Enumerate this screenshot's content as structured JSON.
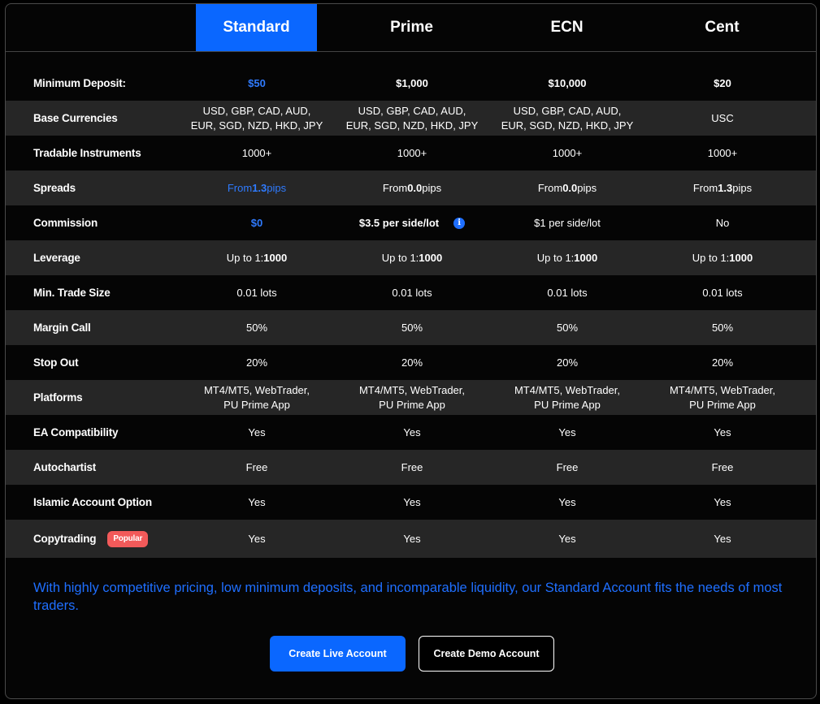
{
  "header": {
    "columns": [
      "Standard",
      "Prime",
      "ECN",
      "Cent"
    ]
  },
  "rows": [
    {
      "label": "Minimum Deposit:",
      "values": [
        "$50",
        "$1,000",
        "$10,000",
        "$20"
      ]
    },
    {
      "label": "Base Currencies",
      "values": [
        "USD, GBP, CAD, AUD,\nEUR, SGD, NZD, HKD, JPY",
        "USD, GBP, CAD, AUD,\nEUR, SGD, NZD, HKD, JPY",
        "USD, GBP, CAD, AUD,\nEUR, SGD, NZD, HKD, JPY",
        "USC"
      ]
    },
    {
      "label": "Tradable Instruments",
      "values": [
        "1000+",
        "1000+",
        "1000+",
        "1000+"
      ]
    },
    {
      "label": "Spreads",
      "values": [
        "From 1.3 pips",
        "From 0.0 pips",
        "From 0.0 pips",
        "From 1.3 pips"
      ]
    },
    {
      "label": "Commission",
      "values": [
        "$0",
        "$3.5 per side/lot",
        "$1 per side/lot",
        "No"
      ]
    },
    {
      "label": "Leverage",
      "values": [
        "Up to 1:1000",
        "Up to 1:1000",
        "Up to 1:1000",
        "Up to 1:1000"
      ]
    },
    {
      "label": "Min. Trade Size",
      "values": [
        "0.01 lots",
        "0.01 lots",
        "0.01 lots",
        "0.01 lots"
      ]
    },
    {
      "label": "Margin Call",
      "values": [
        "50%",
        "50%",
        "50%",
        "50%"
      ]
    },
    {
      "label": "Stop Out",
      "values": [
        "20%",
        "20%",
        "20%",
        "20%"
      ]
    },
    {
      "label": "Platforms",
      "values": [
        "MT4/MT5, WebTrader,\nPU Prime App",
        "MT4/MT5, WebTrader,\nPU Prime App",
        "MT4/MT5, WebTrader,\nPU Prime App",
        "MT4/MT5, WebTrader,\nPU Prime App"
      ]
    },
    {
      "label": "EA Compatibility",
      "values": [
        "Yes",
        "Yes",
        "Yes",
        "Yes"
      ]
    },
    {
      "label": "Autochartist",
      "values": [
        "Free",
        "Free",
        "Free",
        "Free"
      ]
    },
    {
      "label": "Islamic Account Option",
      "values": [
        "Yes",
        "Yes",
        "Yes",
        "Yes"
      ]
    },
    {
      "label": "Copytrading",
      "badge": "Popular",
      "values": [
        "Yes",
        "Yes",
        "Yes",
        "Yes"
      ]
    }
  ],
  "info_icon_glyph": "i",
  "footer": {
    "description": "With highly competitive pricing, low minimum deposits, and incomparable liquidity, our Standard Account fits the needs of most traders.",
    "live_button": "Create Live Account",
    "demo_button": "Create Demo Account"
  },
  "colors": {
    "accent": "#0a67ff",
    "badge": "#f25a5a",
    "alt_row": "#262626"
  }
}
